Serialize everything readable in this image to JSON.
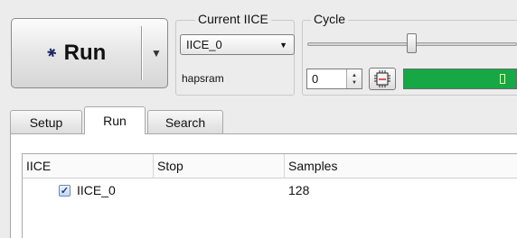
{
  "run_button": {
    "label": "Run",
    "icon": "running-figure-icon",
    "dropdown_icon": "triangle-down-icon"
  },
  "current_iice": {
    "title": "Current IICE",
    "selected": "IICE_0",
    "caption": "hapsram"
  },
  "cycle": {
    "title": "Cycle",
    "value": "0",
    "slider_level_fraction": 0.48,
    "progress_fraction": 1.0,
    "progress_color": "#15a845"
  },
  "tabs": [
    {
      "label": "Setup",
      "active": false
    },
    {
      "label": "Run",
      "active": true
    },
    {
      "label": "Search",
      "active": false
    }
  ],
  "table": {
    "headers": [
      "IICE",
      "Stop",
      "Samples"
    ],
    "rows": [
      {
        "checked": true,
        "iice": "IICE_0",
        "stop": "",
        "samples": "128"
      }
    ]
  }
}
